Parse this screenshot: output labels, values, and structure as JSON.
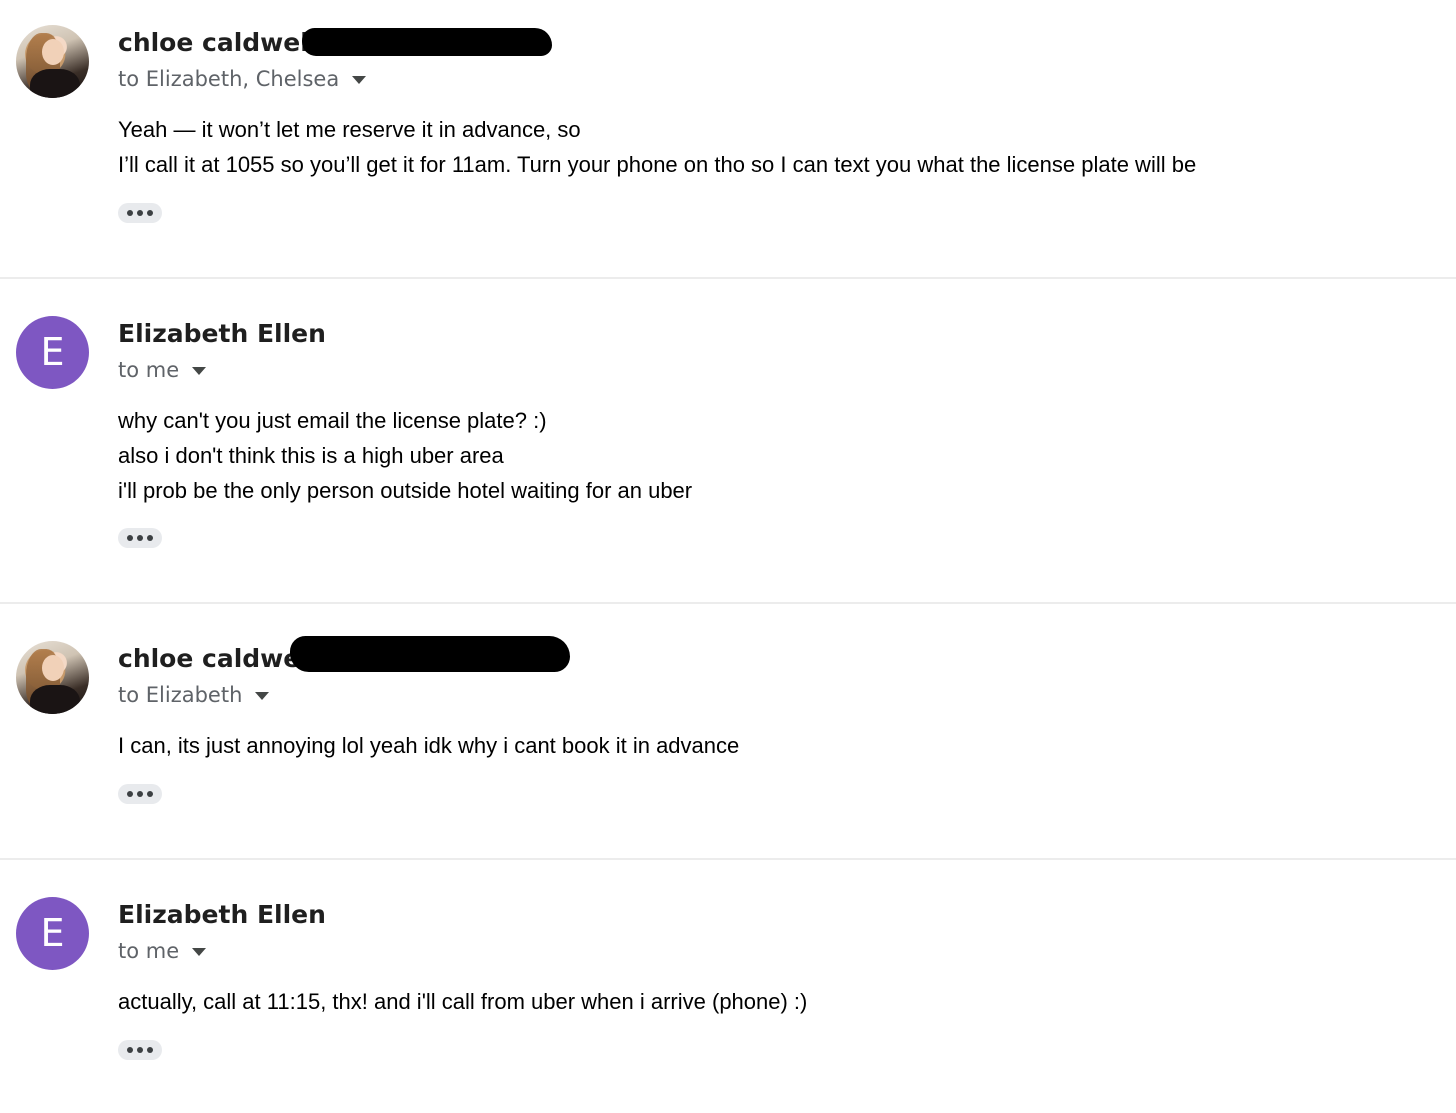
{
  "messages": [
    {
      "sender": "chloe caldwell",
      "avatar": {
        "type": "photo"
      },
      "recipients": "to Elizabeth, Chelsea",
      "body": [
        "Yeah — it won’t let me reserve it in advance, so",
        "I’ll call it at 1055 so you’ll get it for 11am. Turn your phone on tho so I can text you what the license plate will be"
      ]
    },
    {
      "sender": "Elizabeth Ellen",
      "avatar": {
        "type": "letter",
        "letter": "E",
        "color": "#7e57c2"
      },
      "recipients": "to me",
      "body": [
        "why can't you just email the license plate? :)",
        "also i don't think this is a high uber area",
        "i'll prob be the only person outside hotel waiting for an uber"
      ]
    },
    {
      "sender": "chloe caldwell",
      "avatar": {
        "type": "photo"
      },
      "recipients": "to Elizabeth",
      "body": [
        "I can, its just annoying lol yeah idk why i cant book it in advance"
      ]
    },
    {
      "sender": "Elizabeth Ellen",
      "avatar": {
        "type": "letter",
        "letter": "E",
        "color": "#7e57c2"
      },
      "recipients": "to me",
      "body": [
        "actually, call at 11:15, thx! and i'll call from uber when i arrive (phone) :)"
      ]
    }
  ],
  "colors": {
    "divider": "#ececec",
    "avatar_letter_bg": "#7e57c2",
    "secondary_text": "#5f6368"
  },
  "icons": {
    "recipient_toggle": "caret-down-icon",
    "show_trimmed": "more-horizontal-icon"
  }
}
